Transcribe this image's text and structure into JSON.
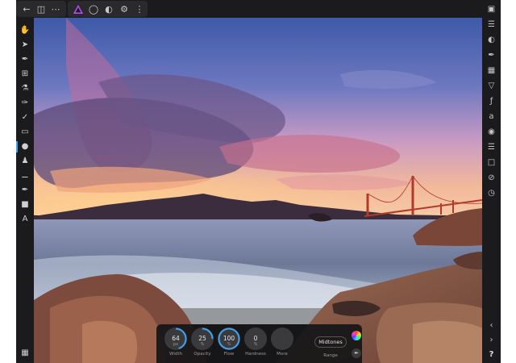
{
  "topbar": {
    "back_icon": "back-arrow-icon",
    "document_icon": "document-icon",
    "more_icon": "more-dots-icon",
    "persona_icon": "affinity-photo-persona-icon",
    "liquify_icon": "liquify-persona-icon",
    "develop_icon": "develop-persona-icon",
    "tone_map_icon": "tone-mapping-persona-icon",
    "export_icon": "export-persona-icon",
    "accent_color": "#c14bff"
  },
  "context_toolbar": {
    "dials": [
      {
        "value": "64",
        "unit": "px",
        "label": "Width",
        "fraction": 0.45
      },
      {
        "value": "25",
        "unit": "%",
        "label": "Opacity",
        "fraction": 0.25
      },
      {
        "value": "100",
        "unit": "%",
        "label": "Flow",
        "fraction": 1.0
      },
      {
        "value": "0",
        "unit": "%",
        "label": "Hardness",
        "fraction": 0.0
      },
      {
        "value": "",
        "unit": "",
        "label": "More",
        "fraction": 0.0
      }
    ],
    "range": {
      "value": "Midtones",
      "label": "Range"
    }
  },
  "right_toolbar": {
    "help_label": "?"
  },
  "colors": {
    "panel": "#1b1b1d",
    "accent_blue": "#3fa3f5"
  }
}
